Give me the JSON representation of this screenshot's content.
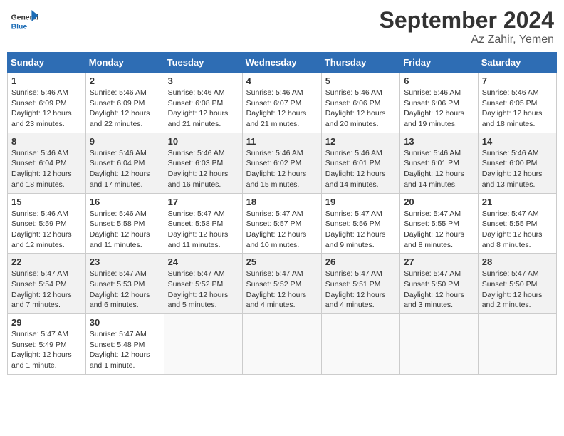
{
  "header": {
    "logo_general": "General",
    "logo_blue": "Blue",
    "month_title": "September 2024",
    "location": "Az Zahir, Yemen"
  },
  "calendar": {
    "days_of_week": [
      "Sunday",
      "Monday",
      "Tuesday",
      "Wednesday",
      "Thursday",
      "Friday",
      "Saturday"
    ],
    "weeks": [
      [
        null,
        null,
        null,
        null,
        null,
        null,
        null
      ]
    ],
    "cells": {
      "1": {
        "sunrise": "5:46 AM",
        "sunset": "6:09 PM",
        "daylight": "12 hours and 23 minutes."
      },
      "2": {
        "sunrise": "5:46 AM",
        "sunset": "6:09 PM",
        "daylight": "12 hours and 22 minutes."
      },
      "3": {
        "sunrise": "5:46 AM",
        "sunset": "6:08 PM",
        "daylight": "12 hours and 21 minutes."
      },
      "4": {
        "sunrise": "5:46 AM",
        "sunset": "6:07 PM",
        "daylight": "12 hours and 21 minutes."
      },
      "5": {
        "sunrise": "5:46 AM",
        "sunset": "6:06 PM",
        "daylight": "12 hours and 20 minutes."
      },
      "6": {
        "sunrise": "5:46 AM",
        "sunset": "6:06 PM",
        "daylight": "12 hours and 19 minutes."
      },
      "7": {
        "sunrise": "5:46 AM",
        "sunset": "6:05 PM",
        "daylight": "12 hours and 18 minutes."
      },
      "8": {
        "sunrise": "5:46 AM",
        "sunset": "6:04 PM",
        "daylight": "12 hours and 18 minutes."
      },
      "9": {
        "sunrise": "5:46 AM",
        "sunset": "6:04 PM",
        "daylight": "12 hours and 17 minutes."
      },
      "10": {
        "sunrise": "5:46 AM",
        "sunset": "6:03 PM",
        "daylight": "12 hours and 16 minutes."
      },
      "11": {
        "sunrise": "5:46 AM",
        "sunset": "6:02 PM",
        "daylight": "12 hours and 15 minutes."
      },
      "12": {
        "sunrise": "5:46 AM",
        "sunset": "6:01 PM",
        "daylight": "12 hours and 14 minutes."
      },
      "13": {
        "sunrise": "5:46 AM",
        "sunset": "6:01 PM",
        "daylight": "12 hours and 14 minutes."
      },
      "14": {
        "sunrise": "5:46 AM",
        "sunset": "6:00 PM",
        "daylight": "12 hours and 13 minutes."
      },
      "15": {
        "sunrise": "5:46 AM",
        "sunset": "5:59 PM",
        "daylight": "12 hours and 12 minutes."
      },
      "16": {
        "sunrise": "5:46 AM",
        "sunset": "5:58 PM",
        "daylight": "12 hours and 11 minutes."
      },
      "17": {
        "sunrise": "5:47 AM",
        "sunset": "5:58 PM",
        "daylight": "12 hours and 11 minutes."
      },
      "18": {
        "sunrise": "5:47 AM",
        "sunset": "5:57 PM",
        "daylight": "12 hours and 10 minutes."
      },
      "19": {
        "sunrise": "5:47 AM",
        "sunset": "5:56 PM",
        "daylight": "12 hours and 9 minutes."
      },
      "20": {
        "sunrise": "5:47 AM",
        "sunset": "5:55 PM",
        "daylight": "12 hours and 8 minutes."
      },
      "21": {
        "sunrise": "5:47 AM",
        "sunset": "5:55 PM",
        "daylight": "12 hours and 8 minutes."
      },
      "22": {
        "sunrise": "5:47 AM",
        "sunset": "5:54 PM",
        "daylight": "12 hours and 7 minutes."
      },
      "23": {
        "sunrise": "5:47 AM",
        "sunset": "5:53 PM",
        "daylight": "12 hours and 6 minutes."
      },
      "24": {
        "sunrise": "5:47 AM",
        "sunset": "5:52 PM",
        "daylight": "12 hours and 5 minutes."
      },
      "25": {
        "sunrise": "5:47 AM",
        "sunset": "5:52 PM",
        "daylight": "12 hours and 4 minutes."
      },
      "26": {
        "sunrise": "5:47 AM",
        "sunset": "5:51 PM",
        "daylight": "12 hours and 4 minutes."
      },
      "27": {
        "sunrise": "5:47 AM",
        "sunset": "5:50 PM",
        "daylight": "12 hours and 3 minutes."
      },
      "28": {
        "sunrise": "5:47 AM",
        "sunset": "5:50 PM",
        "daylight": "12 hours and 2 minutes."
      },
      "29": {
        "sunrise": "5:47 AM",
        "sunset": "5:49 PM",
        "daylight": "12 hours and 1 minute."
      },
      "30": {
        "sunrise": "5:47 AM",
        "sunset": "5:48 PM",
        "daylight": "12 hours and 1 minute."
      }
    }
  }
}
